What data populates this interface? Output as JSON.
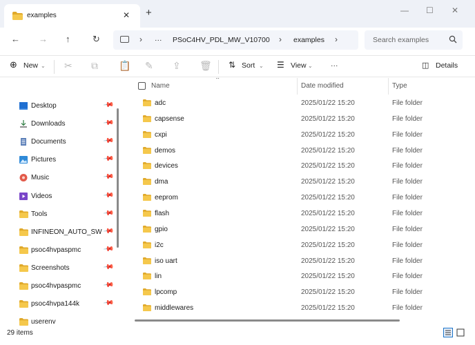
{
  "window": {
    "tab_title": "examples",
    "new_tab_symbol": "+",
    "close_tab_symbol": "✕",
    "minimize_symbol": "—",
    "maximize_symbol": "☐",
    "close_symbol": "✕"
  },
  "address": {
    "overflow": "···",
    "segments": [
      "PSoC4HV_PDL_MW_V10700",
      "examples"
    ],
    "search_placeholder": "Search examples"
  },
  "toolbar": {
    "new_label": "New",
    "sort_label": "Sort",
    "view_label": "View",
    "more_label": "···",
    "details_label": "Details"
  },
  "sidebar": {
    "items": [
      {
        "label": "Desktop",
        "icon": "desktop-icon",
        "pinned": true
      },
      {
        "label": "Downloads",
        "icon": "download-icon",
        "pinned": true
      },
      {
        "label": "Documents",
        "icon": "document-icon",
        "pinned": true
      },
      {
        "label": "Pictures",
        "icon": "pictures-icon",
        "pinned": true
      },
      {
        "label": "Music",
        "icon": "music-icon",
        "pinned": true
      },
      {
        "label": "Videos",
        "icon": "videos-icon",
        "pinned": true
      },
      {
        "label": "Tools",
        "icon": "folder-icon",
        "pinned": true
      },
      {
        "label": "INFINEON_AUTO_SW",
        "icon": "folder-icon",
        "pinned": true
      },
      {
        "label": "psoc4hvpaspmc",
        "icon": "folder-icon",
        "pinned": true
      },
      {
        "label": "Screenshots",
        "icon": "folder-icon",
        "pinned": true
      },
      {
        "label": "psoc4hvpaspmc",
        "icon": "folder-icon",
        "pinned": true
      },
      {
        "label": "psoc4hvpa144k",
        "icon": "folder-icon",
        "pinned": true
      },
      {
        "label": "userenv",
        "icon": "folder-icon",
        "pinned": false
      }
    ]
  },
  "columns": {
    "name": "Name",
    "date": "Date modified",
    "type": "Type"
  },
  "files": [
    {
      "name": "adc",
      "date": "2025/01/22 15:20",
      "type": "File folder"
    },
    {
      "name": "capsense",
      "date": "2025/01/22 15:20",
      "type": "File folder"
    },
    {
      "name": "cxpi",
      "date": "2025/01/22 15:20",
      "type": "File folder"
    },
    {
      "name": "demos",
      "date": "2025/01/22 15:20",
      "type": "File folder"
    },
    {
      "name": "devices",
      "date": "2025/01/22 15:20",
      "type": "File folder"
    },
    {
      "name": "dma",
      "date": "2025/01/22 15:20",
      "type": "File folder"
    },
    {
      "name": "eeprom",
      "date": "2025/01/22 15:20",
      "type": "File folder"
    },
    {
      "name": "flash",
      "date": "2025/01/22 15:20",
      "type": "File folder"
    },
    {
      "name": "gpio",
      "date": "2025/01/22 15:20",
      "type": "File folder"
    },
    {
      "name": "i2c",
      "date": "2025/01/22 15:20",
      "type": "File folder"
    },
    {
      "name": "iso uart",
      "date": "2025/01/22 15:20",
      "type": "File folder"
    },
    {
      "name": "lin",
      "date": "2025/01/22 15:20",
      "type": "File folder"
    },
    {
      "name": "lpcomp",
      "date": "2025/01/22 15:20",
      "type": "File folder"
    },
    {
      "name": "middlewares",
      "date": "2025/01/22 15:20",
      "type": "File folder"
    }
  ],
  "status": {
    "item_count": "29 items"
  },
  "colors": {
    "folder": "#f2c14e",
    "folder_dark": "#e0a92a",
    "accent": "#1a73c8"
  }
}
